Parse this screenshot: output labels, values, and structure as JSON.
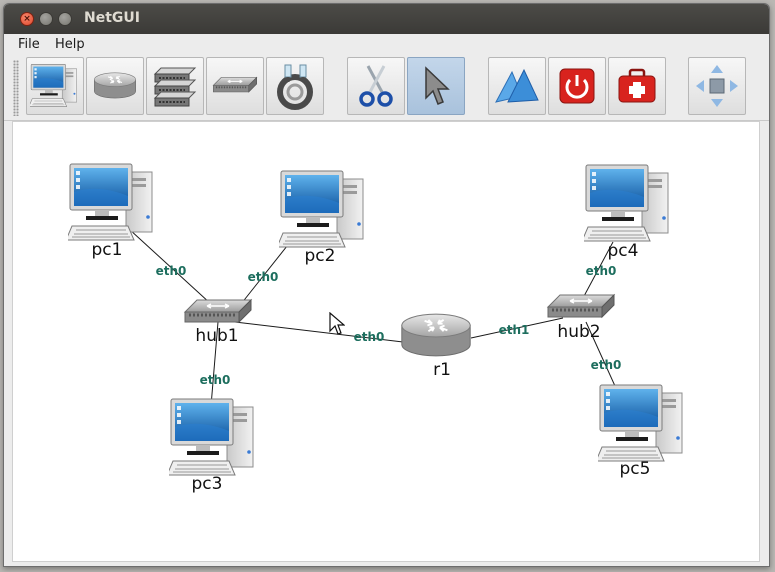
{
  "window": {
    "title": "NetGUI"
  },
  "menu": {
    "file": "File",
    "help": "Help"
  },
  "toolbar": {
    "buttons": [
      {
        "name": "terminal",
        "icon": "computer-icon"
      },
      {
        "name": "router",
        "icon": "router-icon"
      },
      {
        "name": "switch",
        "icon": "switch-icon"
      },
      {
        "name": "hub",
        "icon": "hub-icon"
      },
      {
        "name": "cable",
        "icon": "cable-icon"
      },
      {
        "name": "cut",
        "icon": "scissors-icon"
      },
      {
        "name": "select",
        "icon": "pointer-icon",
        "active": true
      },
      {
        "name": "start",
        "icon": "start-icon"
      },
      {
        "name": "power",
        "icon": "power-icon"
      },
      {
        "name": "emergency",
        "icon": "first-aid-icon"
      },
      {
        "name": "move",
        "icon": "move-arrows-icon"
      }
    ]
  },
  "network": {
    "nodes": {
      "pc1": "pc1",
      "pc2": "pc2",
      "pc3": "pc3",
      "pc4": "pc4",
      "pc5": "pc5",
      "hub1": "hub1",
      "hub2": "hub2",
      "r1": "r1"
    },
    "links": {
      "pc1_hub1": "eth0",
      "pc2_hub1": "eth0",
      "pc3_hub1": "eth0",
      "r1_hub1": "eth0",
      "r1_hub2": "eth1",
      "pc4_hub2": "eth0",
      "pc5_hub2": "eth0"
    }
  },
  "colors": {
    "titlebar": "#3b3a37",
    "link_label": "#1d6e5e",
    "active_tool": "#a9c2dc"
  }
}
